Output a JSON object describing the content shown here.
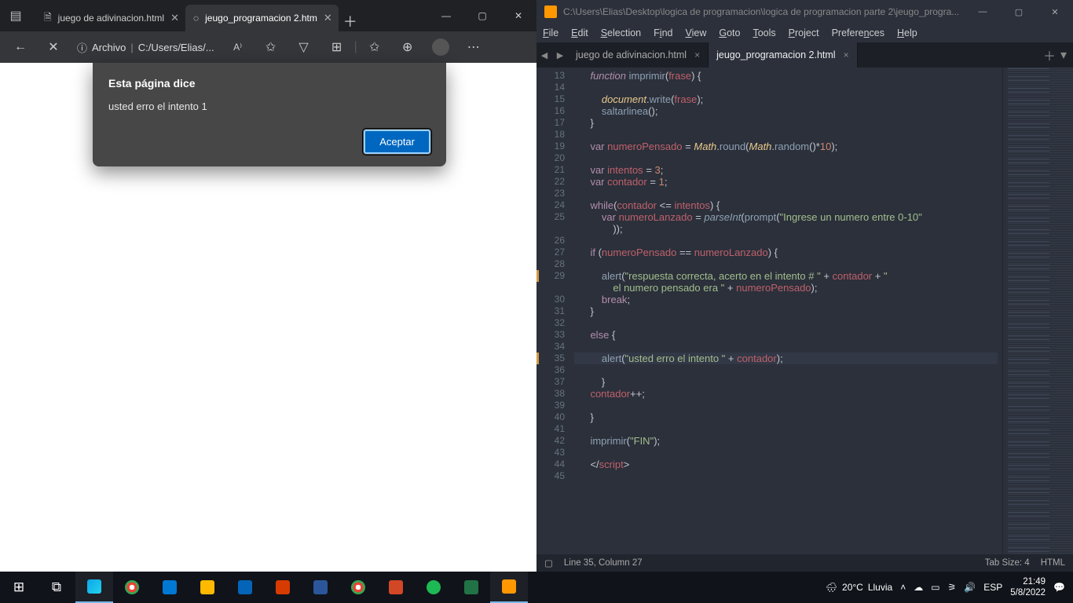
{
  "browser": {
    "tabs": [
      {
        "title": "juego de adivinacion.html",
        "active": false
      },
      {
        "title": "jeugo_programacion 2.htm",
        "active": true
      }
    ],
    "address_label": "Archivo",
    "address_path": "C:/Users/Elias/...",
    "dialog": {
      "title": "Esta página dice",
      "message": "usted erro el intento 1",
      "accept": "Aceptar"
    }
  },
  "editor": {
    "title_path": "C:\\Users\\Elias\\Desktop\\logica de programacion\\logica de programacion parte 2\\jeugo_progra...",
    "menu": [
      "File",
      "Edit",
      "Selection",
      "Find",
      "View",
      "Goto",
      "Tools",
      "Project",
      "Preferences",
      "Help"
    ],
    "tabs": [
      {
        "title": "juego de adivinacion.html",
        "active": false
      },
      {
        "title": "jeugo_programacion 2.html",
        "active": true
      }
    ],
    "line_start": 13,
    "line_end": 45,
    "modified_lines": [
      29,
      35
    ],
    "highlighted_line": 35,
    "status": {
      "pos": "Line 35, Column 27",
      "tab": "Tab Size: 4",
      "lang": "HTML"
    },
    "code_lines": [
      {
        "n": 13,
        "html": "    <span class='kw'>function</span> <span class='fn'>imprimir</span><span class='pun'>(</span><span class='var'>frase</span><span class='pun'>) {</span>"
      },
      {
        "n": 14,
        "html": ""
      },
      {
        "n": 15,
        "html": "        <span class='sup'>document</span><span class='pun'>.</span><span class='call'>write</span><span class='pun'>(</span><span class='var'>frase</span><span class='pun'>);</span>"
      },
      {
        "n": 16,
        "html": "        <span class='call'>saltarlinea</span><span class='pun'>();</span>"
      },
      {
        "n": 17,
        "html": "    <span class='pun'>}</span>"
      },
      {
        "n": 18,
        "html": ""
      },
      {
        "n": 19,
        "html": "    <span class='kw2'>var</span> <span class='var'>numeroPensado</span> <span class='op'>=</span> <span class='sup'>Math</span><span class='pun'>.</span><span class='call'>round</span><span class='pun'>(</span><span class='sup'>Math</span><span class='pun'>.</span><span class='call'>random</span><span class='pun'>()</span><span class='op'>*</span><span class='num'>10</span><span class='pun'>);</span>"
      },
      {
        "n": 20,
        "html": ""
      },
      {
        "n": 21,
        "html": "    <span class='kw2'>var</span> <span class='var'>intentos</span> <span class='op'>=</span> <span class='num'>3</span><span class='pun'>;</span>"
      },
      {
        "n": 22,
        "html": "    <span class='kw2'>var</span> <span class='var'>contador</span> <span class='op'>=</span> <span class='num'>1</span><span class='pun'>;</span>"
      },
      {
        "n": 23,
        "html": ""
      },
      {
        "n": 24,
        "html": "    <span class='kw2'>while</span><span class='pun'>(</span><span class='var'>contador</span> <span class='op'>&lt;=</span> <span class='var'>intentos</span><span class='pun'>) {</span>"
      },
      {
        "n": 25,
        "html": "        <span class='kw2'>var</span> <span class='var'>numeroLanzado</span> <span class='op'>=</span> <span class='builtin'>parseInt</span><span class='pun'>(</span><span class='call'>prompt</span><span class='pun'>(</span><span class='str'>\"Ingrese un numero entre 0-10\"</span><br>            <span class='pun'>));</span>"
      },
      {
        "n": 26,
        "html": ""
      },
      {
        "n": 27,
        "html": "    <span class='kw2'>if</span> <span class='pun'>(</span><span class='var'>numeroPensado</span> <span class='op'>==</span> <span class='var'>numeroLanzado</span><span class='pun'>) {</span>"
      },
      {
        "n": 28,
        "html": ""
      },
      {
        "n": 29,
        "html": "        <span class='call'>alert</span><span class='pun'>(</span><span class='str'>\"respuesta correcta, acerto en el intento # \"</span> <span class='op'>+</span> <span class='var'>contador</span> <span class='op'>+</span> <span class='str'>\"</span><br>            <span class='str'>el numero pensado era \"</span> <span class='op'>+</span> <span class='var'>numeroPensado</span><span class='pun'>);</span>"
      },
      {
        "n": 30,
        "html": "        <span class='kw2'>break</span><span class='pun'>;</span>"
      },
      {
        "n": 31,
        "html": "    <span class='pun'>}</span>"
      },
      {
        "n": 32,
        "html": ""
      },
      {
        "n": 33,
        "html": "    <span class='kw2'>else</span> <span class='pun'>{</span>"
      },
      {
        "n": 34,
        "html": ""
      },
      {
        "n": 35,
        "html": "        <span class='call'>alert</span><span class='pun'>(</span><span class='str'>\"usted erro el intento \"</span> <span class='op'>+</span> <span class='var'>contador</span><span class='pun'>);</span>"
      },
      {
        "n": 36,
        "html": ""
      },
      {
        "n": 37,
        "html": "        <span class='pun'>}</span>"
      },
      {
        "n": 38,
        "html": "    <span class='var'>contador</span><span class='op'>++</span><span class='pun'>;</span>"
      },
      {
        "n": 39,
        "html": ""
      },
      {
        "n": 40,
        "html": "    <span class='pun'>}</span>"
      },
      {
        "n": 41,
        "html": ""
      },
      {
        "n": 42,
        "html": "    <span class='call'>imprimir</span><span class='pun'>(</span><span class='str'>\"FIN\"</span><span class='pun'>);</span>"
      },
      {
        "n": 43,
        "html": ""
      },
      {
        "n": 44,
        "html": "    <span class='pun'>&lt;/</span><span class='tag'>script</span><span class='pun'>&gt;</span>"
      },
      {
        "n": 45,
        "html": ""
      }
    ]
  },
  "taskbar": {
    "weather_temp": "20°C",
    "weather_desc": "Lluvia",
    "lang": "ESP",
    "time": "21:49",
    "date": "5/8/2022"
  }
}
